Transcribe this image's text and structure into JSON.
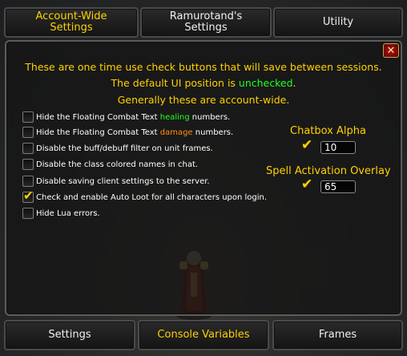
{
  "top_tabs": [
    {
      "label": "Account-Wide Settings"
    },
    {
      "label": "Ramurotand's Settings"
    },
    {
      "label": "Utility"
    }
  ],
  "info": {
    "line1": "These are one time use check buttons that will save between sessions.",
    "line2_prefix": "The default UI position is ",
    "line2_highlight": "unchecked",
    "line2_suffix": ".",
    "line3": "Generally these are account-wide."
  },
  "options": [
    {
      "prefix": "Hide the Floating Combat Text ",
      "highlight": "healing",
      "suffix": " numbers.",
      "checked": false
    },
    {
      "prefix": "Hide the Floating Combat Text ",
      "highlight": "damage",
      "suffix": " numbers.",
      "checked": false
    },
    {
      "label": "Disable the buff/debuff filter on unit frames.",
      "checked": false
    },
    {
      "label": "Disable the class colored names in chat.",
      "checked": false
    },
    {
      "label": "Disable saving client settings to the server.",
      "checked": false
    },
    {
      "label": "Check and enable Auto Loot for all characters upon login.",
      "checked": true
    },
    {
      "label": "Hide Lua errors.",
      "checked": false
    }
  ],
  "settings": [
    {
      "label": "Chatbox Alpha",
      "checked": true,
      "value": "10"
    },
    {
      "label": "Spell Activation Overlay",
      "checked": true,
      "value": "65"
    }
  ],
  "bottom_tabs": [
    {
      "label": "Settings"
    },
    {
      "label": "Console Variables"
    },
    {
      "label": "Frames"
    }
  ],
  "close_glyph": "✕",
  "check_glyph": "✔",
  "colors": {
    "gold": "#ffd100",
    "green": "#20ff20",
    "orange": "#ff8c1a",
    "close_red": "#b01212"
  }
}
